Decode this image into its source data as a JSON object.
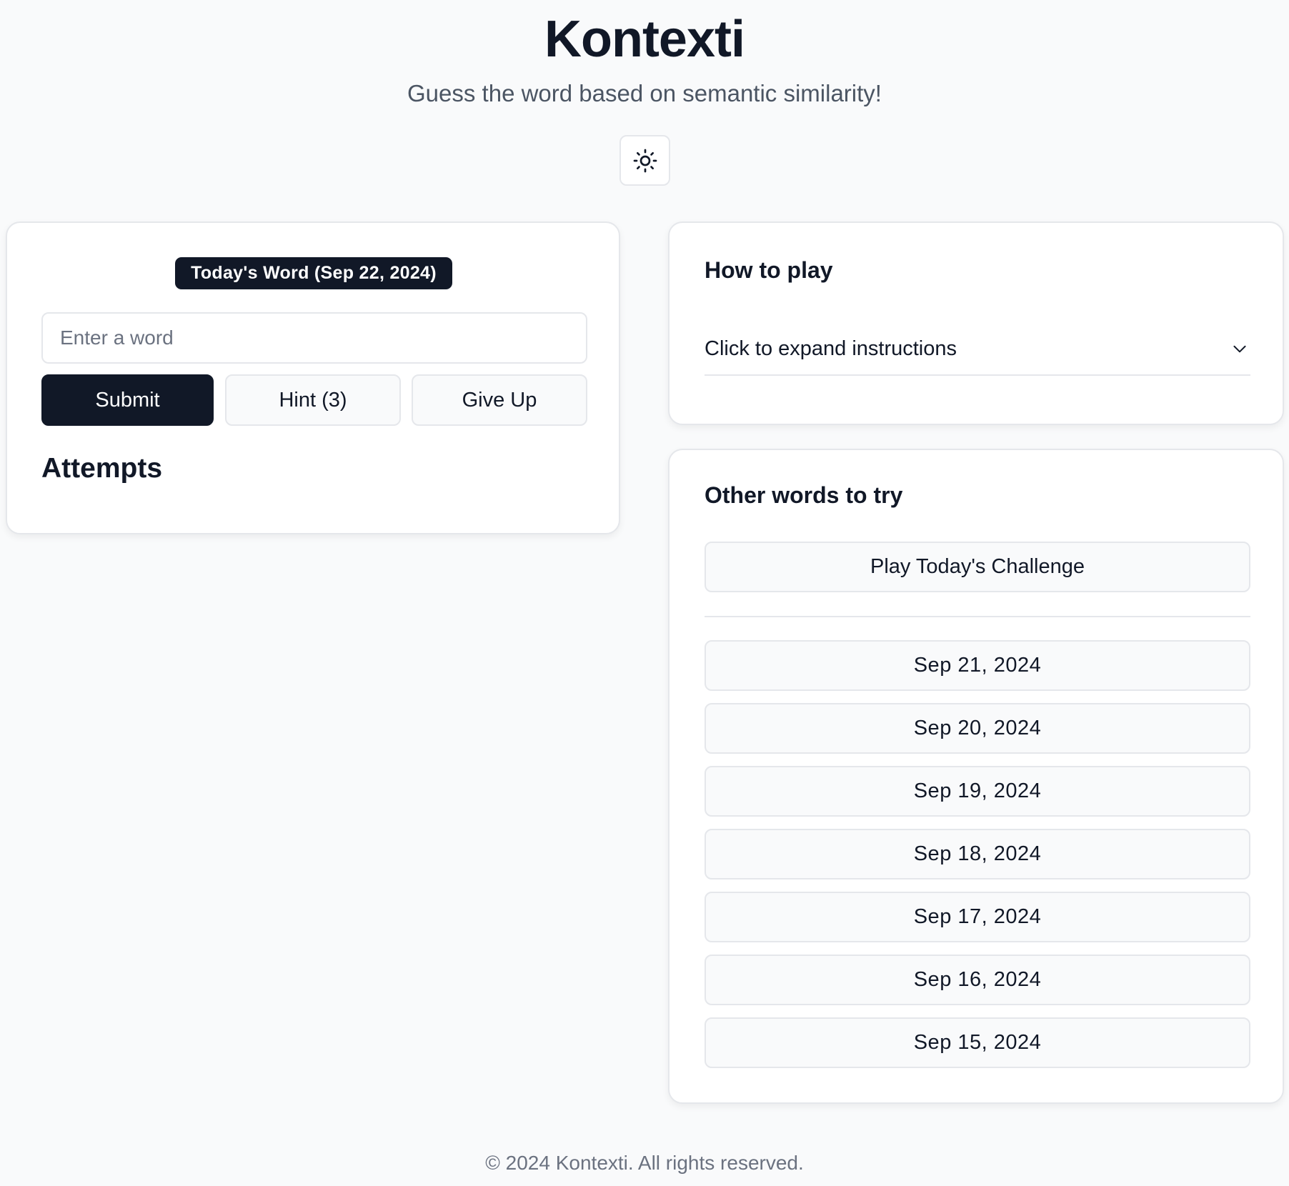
{
  "header": {
    "title": "Kontexti",
    "subtitle": "Guess the word based on semantic similarity!",
    "theme_toggle_icon": "sun-icon"
  },
  "game": {
    "badge": "Today's Word (Sep 22, 2024)",
    "input": {
      "placeholder": "Enter a word",
      "value": ""
    },
    "submit_label": "Submit",
    "hint_label": "Hint (3)",
    "give_up_label": "Give Up",
    "attempts_heading": "Attempts"
  },
  "how_to_play": {
    "heading": "How to play",
    "expand_label": "Click to expand instructions",
    "expand_icon": "chevron-down-icon"
  },
  "other_words": {
    "heading": "Other words to try",
    "challenge_label": "Play Today's Challenge",
    "dates": [
      "Sep 21, 2024",
      "Sep 20, 2024",
      "Sep 19, 2024",
      "Sep 18, 2024",
      "Sep 17, 2024",
      "Sep 16, 2024",
      "Sep 15, 2024"
    ]
  },
  "footer": {
    "text": "© 2024 Kontexti. All rights reserved."
  },
  "colors": {
    "background": "#f9fafb",
    "primary": "#111827",
    "border": "#e5e7eb",
    "muted_text": "#6b7280"
  }
}
